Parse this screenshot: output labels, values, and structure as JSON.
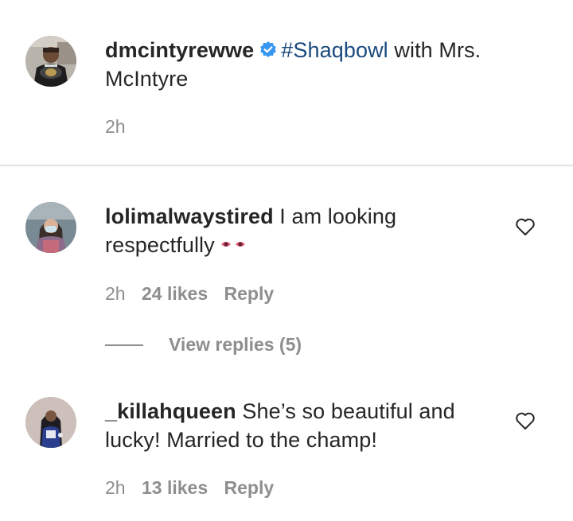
{
  "post": {
    "username": "dmcintyrewwe",
    "hashtag": "#Shaqbowl",
    "caption": " with Mrs. McIntyre",
    "time": "2h"
  },
  "comments": [
    {
      "username": "lolimalwaystired",
      "text": " I am looking respectfully",
      "emoji": "eyes-emoji",
      "time": "2h",
      "likes": "24 likes",
      "reply": "Reply",
      "view_replies": "View replies (5)"
    },
    {
      "username": "_killahqueen",
      "text": " She’s so beautiful and lucky! Married to the champ!",
      "time": "2h",
      "likes": "13 likes",
      "reply": "Reply"
    }
  ],
  "colors": {
    "text": "#262626",
    "muted": "#8e8e8e",
    "hashtag": "#1b4a7d",
    "verified": "#3897f0",
    "divider": "#e3e3e3"
  },
  "icons": [
    "verified-badge-icon",
    "heart-icon",
    "eyes-emoji"
  ]
}
